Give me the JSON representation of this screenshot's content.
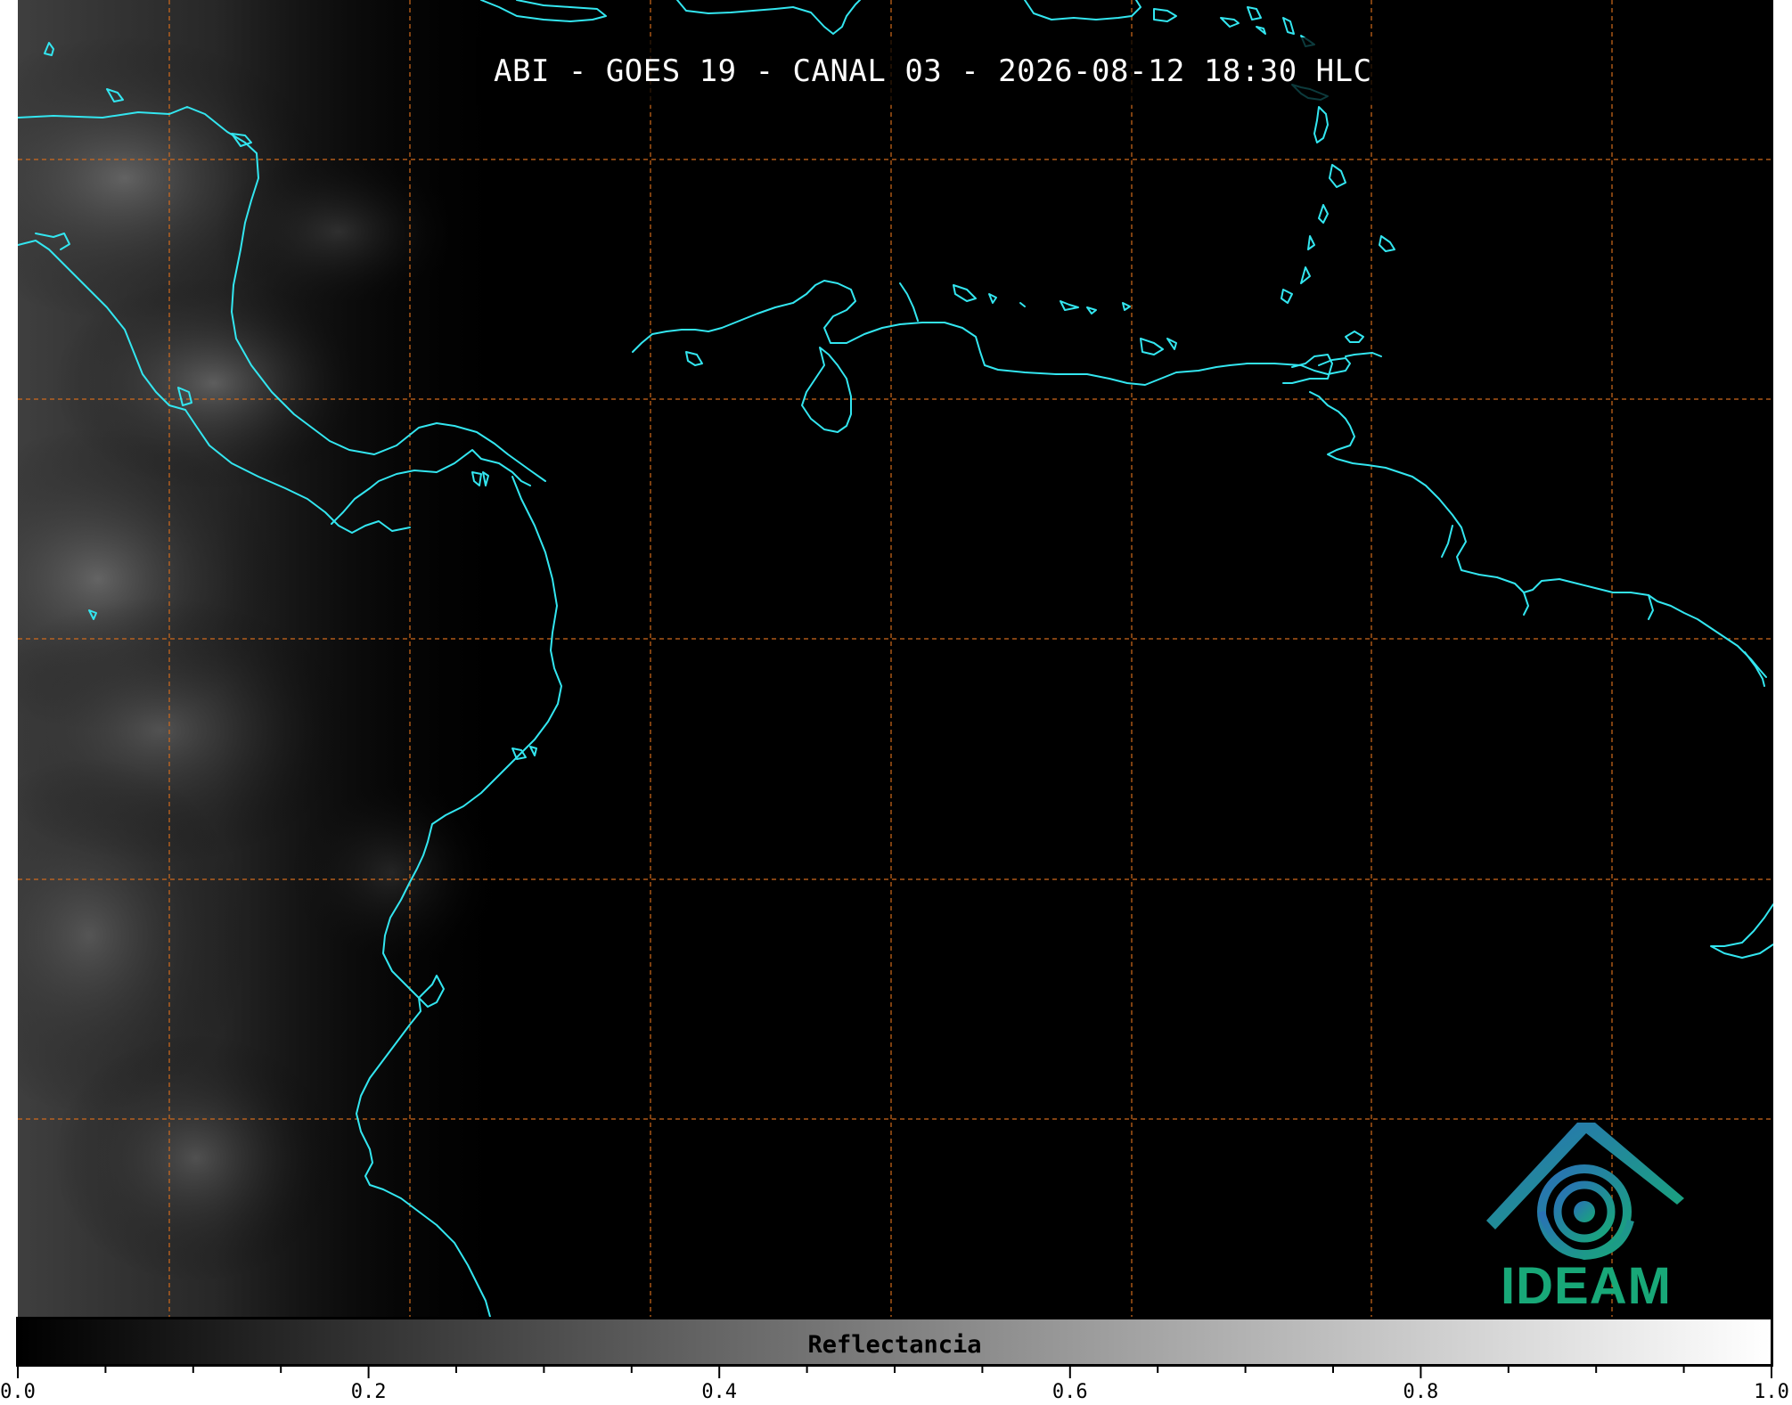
{
  "title": "ABI - GOES 19 - CANAL 03 - 2026-08-12 18:30 HLC",
  "colors": {
    "coastline": "#33e6f0",
    "graticule": "#d06a1c",
    "background": "#000000",
    "logo_primary": "#1f8fb5",
    "logo_secondary": "#18a878"
  },
  "logo": {
    "text": "IDEAM",
    "icon": "ideam-logo-icon"
  },
  "colorbar": {
    "label": "Reflectancia",
    "min": 0.0,
    "max": 1.0,
    "tick_labels": [
      "0.0",
      "0.2",
      "0.4",
      "0.6",
      "0.8",
      "1.0"
    ],
    "tick_values": [
      0.0,
      0.2,
      0.4,
      0.6,
      0.8,
      1.0
    ],
    "minor_tick_step": 0.05
  }
}
